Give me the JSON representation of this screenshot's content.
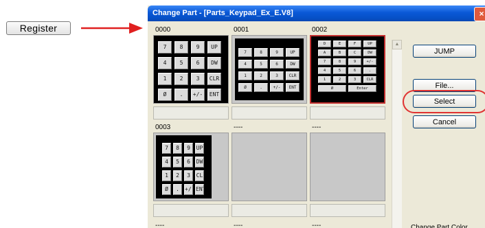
{
  "register_button": "Register",
  "arrow_color": "#e02020",
  "window": {
    "title": "Change Part - [Parts_Keypad_Ex_E.V8]",
    "close_glyph": "×"
  },
  "parts": [
    {
      "label": "0000",
      "selected": false,
      "keys": [
        [
          "7",
          "8",
          "9",
          "UP"
        ],
        [
          "4",
          "5",
          "6",
          "DW"
        ],
        [
          "1",
          "2",
          "3",
          "CLR"
        ],
        [
          "Ø",
          ".",
          "+/-",
          "ENT"
        ]
      ]
    },
    {
      "label": "0001",
      "selected": false,
      "keys": [
        [
          "7",
          "8",
          "9",
          "UP"
        ],
        [
          "4",
          "5",
          "6",
          "DW"
        ],
        [
          "1",
          "2",
          "3",
          "CLR"
        ],
        [
          "Ø",
          ".",
          "+/-",
          "ENT"
        ]
      ]
    },
    {
      "label": "0002",
      "selected": true,
      "keys": [
        [
          "D",
          "E",
          "F",
          "UP"
        ],
        [
          "A",
          "B",
          "C",
          "DW"
        ],
        [
          "7",
          "8",
          "9",
          "+/-"
        ],
        [
          "4",
          "5",
          "6",
          "."
        ],
        [
          "1",
          "2",
          "3",
          "CLR"
        ]
      ],
      "bottom_keys": [
        "Ø",
        "Enter"
      ]
    },
    {
      "label": "0003",
      "selected": false,
      "keys": [
        [
          "7",
          "8",
          "9",
          "UP"
        ],
        [
          "4",
          "5",
          "6",
          "DW"
        ],
        [
          "1",
          "2",
          "3",
          "CL"
        ],
        [
          "Ø",
          ".",
          "+/-",
          "ENT"
        ]
      ]
    },
    {
      "label": "----",
      "selected": false
    },
    {
      "label": "----",
      "selected": false
    },
    {
      "label": "----"
    },
    {
      "label": "----"
    },
    {
      "label": "----"
    }
  ],
  "buttons": {
    "jump": "JUMP",
    "file": "File...",
    "select": "Select",
    "cancel": "Cancel"
  },
  "change_part_color": "Change Part Color",
  "highlight_color": "#e03232"
}
